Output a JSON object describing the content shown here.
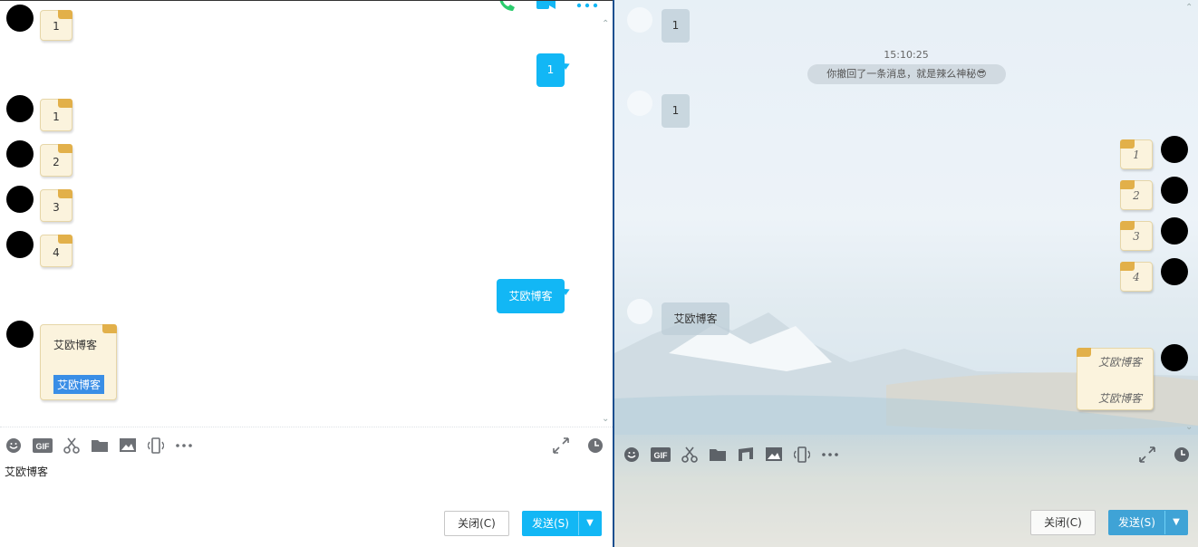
{
  "left": {
    "header_icons": [
      "phone-call-icon",
      "video-call-icon",
      "more-options-icon"
    ],
    "incoming": [
      {
        "text": "1"
      },
      {
        "text": "1"
      },
      {
        "text": "2"
      },
      {
        "text": "3"
      },
      {
        "text": "4"
      }
    ],
    "outgoing": [
      {
        "text": "1"
      },
      {
        "text": "艾欧博客"
      }
    ],
    "note_multi": {
      "line1": "艾欧博客",
      "line2": "艾欧博客"
    },
    "toolbar_icons": [
      "emoji-icon",
      "gif-icon",
      "scissors-icon",
      "folder-icon",
      "image-icon",
      "shake-icon",
      "more-icon"
    ],
    "toolbar_right_icons": [
      "expand-icon",
      "history-icon"
    ],
    "input_text": "艾欧博客",
    "close_label": "关闭(C)",
    "send_label": "发送(S)"
  },
  "right": {
    "incoming": [
      {
        "text": "1"
      },
      {
        "text": "1"
      },
      {
        "text": "艾欧博客"
      }
    ],
    "timestamp": "15:10:25",
    "recall_notice": "你撤回了一条消息，就是辣么神秘",
    "recall_emoji": "😎",
    "outgoing_notes": [
      "1",
      "2",
      "3",
      "4"
    ],
    "note_multi": {
      "line1": "艾欧博客",
      "line2": "艾欧博客"
    },
    "toolbar_icons": [
      "emoji-icon",
      "gif-icon",
      "scissors-icon",
      "folder-icon",
      "music-icon",
      "image-icon",
      "shake-icon",
      "more-icon"
    ],
    "toolbar_right_icons": [
      "expand-icon",
      "history-icon"
    ],
    "close_label": "关闭(C)",
    "send_label": "发送(S)"
  }
}
